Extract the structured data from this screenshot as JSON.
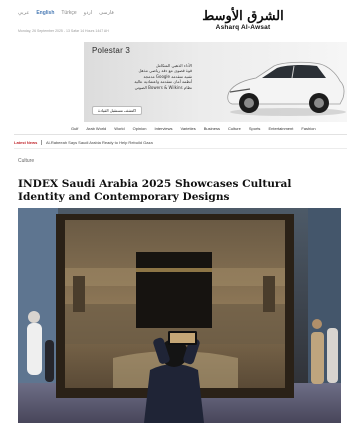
{
  "header": {
    "languages": [
      {
        "label": "عربي",
        "active": false
      },
      {
        "label": "English",
        "active": true
      },
      {
        "label": "Türkçe",
        "active": false
      },
      {
        "label": "اردو",
        "active": false
      },
      {
        "label": "فارسی",
        "active": false
      }
    ],
    "dateline": "Monday, 26 September 2025 - 13 Safar 14 Hours 1447 AH",
    "logo_ar": "الشرق الأوسط",
    "logo_en": "Asharq Al-Awsat"
  },
  "ad": {
    "brand": "Polestar 3",
    "copy_lines": [
      "الأداء الذهبي المتكامل",
      "قوة قصوى مع دقة رياضي مذهل",
      "تقنية متقدمة Google مدمجة",
      "أنظمة أمان متقدمة واعتمادية عالية",
      "نظام Bowers & Wilkins الصوتي"
    ],
    "cta": "اكتشف مستقبل القيادة"
  },
  "nav": {
    "items": [
      "Gulf",
      "Arab World",
      "World",
      "Opinion",
      "Interviews",
      "Varieties",
      "Business",
      "Culture",
      "Sports",
      "Entertainment",
      "Fashion"
    ]
  },
  "ticker": {
    "label": "Latest News",
    "text": "Al-Rabeeah Says Saudi Arabia Ready to Help Rebuild Gaza"
  },
  "article": {
    "category": "Culture",
    "headline": "INDEX Saudi Arabia 2025 Showcases Cultural Identity and Contemporary Designs"
  },
  "colors": {
    "ticker_accent": "#c1272d",
    "active_language": "#4a7bb5"
  }
}
